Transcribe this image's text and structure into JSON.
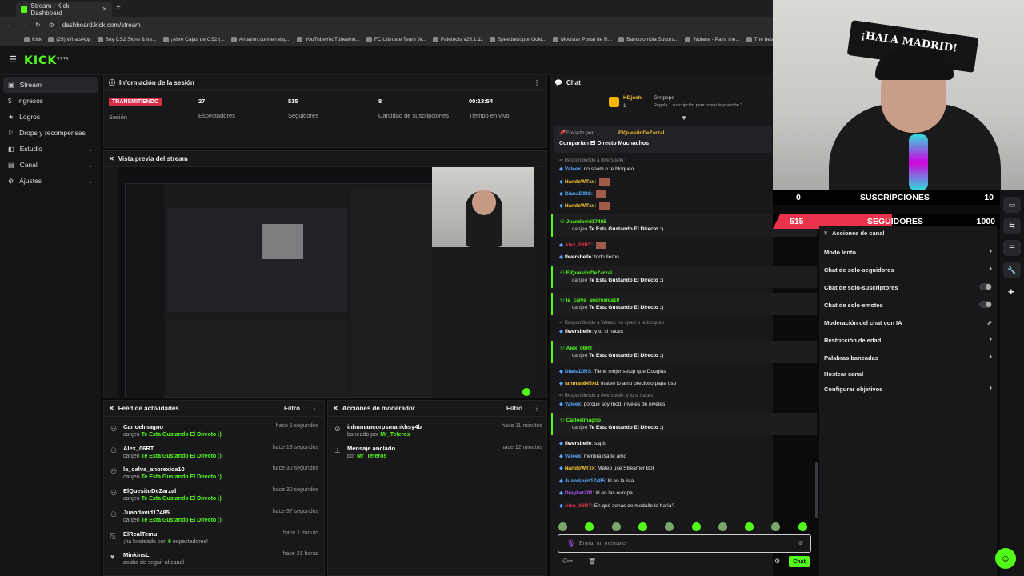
{
  "browser": {
    "tab_title": "Stream - Kick Dashboard",
    "url": "dashboard.kick.com/stream",
    "bookmarks": [
      "Kick",
      "(25) WhatsApp",
      "Buy CS2 Skins & Ite...",
      "¡Abre Cajas de CS2 (...",
      "Amazon.com en esp...",
      "YouTubeYouTubewhtt...",
      "FC Ultimate Team W...",
      "Paletools v25.1.11",
      "Speedtest por Ookl...",
      "Movistar Portal de R...",
      "Bancolombia Sucurs...",
      "Wplace - Paint the...",
      "The best ChatBot an..."
    ]
  },
  "app": {
    "logo": "KICK",
    "logo_tag": "BETA"
  },
  "sidebar": {
    "items": [
      {
        "label": "Stream",
        "icon": "stream-icon",
        "active": true
      },
      {
        "label": "Ingresos",
        "icon": "money-icon"
      },
      {
        "label": "Logros",
        "icon": "trophy-icon"
      },
      {
        "label": "Drops y recompensas",
        "icon": "gift-icon"
      },
      {
        "label": "Estudio",
        "icon": "studio-icon",
        "expandable": true
      },
      {
        "label": "Canal",
        "icon": "channel-icon",
        "expandable": true
      },
      {
        "label": "Ajustes",
        "icon": "gear-icon",
        "expandable": true
      }
    ]
  },
  "session": {
    "title": "Información de la sesión",
    "status": "TRANSMITIENDO",
    "status_label": "Sesión",
    "stats": [
      {
        "value": "27",
        "label": "Espectadores"
      },
      {
        "value": "515",
        "label": "Seguidores"
      },
      {
        "value": "8",
        "label": "Cantidad de suscripciones"
      },
      {
        "value": "00:13:54",
        "label": "Tiempo en vivo"
      }
    ]
  },
  "preview": {
    "title": "Vista previa del stream"
  },
  "feed": {
    "title": "Feed de actividades",
    "filter": "Filtro",
    "rows": [
      {
        "user": "Carloelmagno",
        "pre": "canjeó",
        "highlight": "Te Esta Gustando El Directo :)",
        "time": "hace 5 segundos"
      },
      {
        "user": "Alex_06RT",
        "pre": "canjeó",
        "highlight": "Te Esta Gustando El Directo :)",
        "time": "hace 18 segundos"
      },
      {
        "user": "la_calva_anorexica10",
        "pre": "canjeó",
        "highlight": "Te Esta Gustando El Directo :)",
        "time": "hace 30 segundos"
      },
      {
        "user": "ElQuesitoDeZarzal",
        "pre": "canjeó",
        "highlight": "Te Esta Gustando El Directo :)",
        "time": "hace 30 segundos"
      },
      {
        "user": "Juandavid17485",
        "pre": "canjeó",
        "highlight": "Te Esta Gustando El Directo :)",
        "time": "hace 37 segundos"
      },
      {
        "user": "ElRealTemu",
        "pre": "¡ha hosteado con",
        "highlight": "6",
        "post": "espectadores!",
        "time": "hace 1 minuto"
      },
      {
        "user": "MinkinsL",
        "pre": "acaba de seguir al canal",
        "highlight": "",
        "time": "hace 21 horas"
      }
    ]
  },
  "mod": {
    "title": "Acciones de moderador",
    "filter": "Filtro",
    "rows": [
      {
        "user": "inhumancorpsmankhsy4b",
        "pre": "baneado por",
        "by": "Mr_Teteros",
        "time": "hace 11 minutos"
      },
      {
        "user": "Mensaje anclado",
        "pre": "por",
        "by": "Mr_Teteros",
        "time": "hace 12 minutos"
      }
    ]
  },
  "chat": {
    "title": "Chat",
    "top_gifter": {
      "name": "HDjoshi",
      "count": "1",
      "second": "Grrrpepe",
      "note": "Regala 1 suscripción para tomar la posición 3"
    },
    "pinned": {
      "by_label": "Enviado por",
      "by": "ElQuesitoDeZarzal",
      "text": "Compartan El Directo Muchachos"
    },
    "messages": [
      {
        "reply": "Respondiendo a flwersbelle:",
        "user": "Valeex",
        "color": "#5aa8ff",
        "text": "no spam o te bloqueo"
      },
      {
        "user": "NandoWTxx",
        "color": "#f4c430",
        "text": ""
      },
      {
        "user": "DianaDIRS",
        "color": "#5aa8ff",
        "text": ""
      },
      {
        "user": "NandoWTxx",
        "color": "#f4c430",
        "text": ""
      },
      {
        "user": "Juandavid17485",
        "color": "#53fc18",
        "text": "canjeó",
        "reward": "Te Esta Gustando El Directo :)",
        "hl": true
      },
      {
        "user": "Alex_06RT",
        "color": "#e8334a",
        "text": ""
      },
      {
        "user": "flwersbelle",
        "color": "#ffffff",
        "text": "todo tierno"
      },
      {
        "user": "ElQuesitoDeZarzal",
        "color": "#53fc18",
        "text": "canjeó",
        "reward": "Te Esta Gustando El Directo :)",
        "hl": true
      },
      {
        "user": "la_calva_anorexica10",
        "color": "#53fc18",
        "text": "canjeó",
        "reward": "Te Esta Gustando El Directo :)",
        "hl": true
      },
      {
        "reply": "Respondiendo a Valeex: no spam o te bloqueo",
        "user": "flwersbelle",
        "color": "#ffffff",
        "text": "y tu si haces"
      },
      {
        "user": "Alex_06RT",
        "color": "#53fc18",
        "text": "canjeó",
        "reward": "Te Esta Gustando El Directo :)",
        "hl": true
      },
      {
        "user": "DianaDIRS",
        "color": "#5aa8ff",
        "text": "Tiene mejor setup que Douglas"
      },
      {
        "user": "fanman845xd",
        "color": "#f4c430",
        "text": "mateo lo amo precioso papa oso"
      },
      {
        "reply": "Respondiendo a flwersbelle: y tu si haces",
        "user": "Valeex",
        "color": "#5aa8ff",
        "text": "porque soy mod, niveles de niveles"
      },
      {
        "user": "Carloelmagno",
        "color": "#53fc18",
        "text": "canjeó",
        "reward": "Te Esta Gustando El Directo :)",
        "hl": true
      },
      {
        "user": "flwersbelle",
        "color": "#ffffff",
        "text": "sapis"
      },
      {
        "user": "Valeex",
        "color": "#5aa8ff",
        "text": "mentira lsa te amo"
      },
      {
        "user": "NandoWTxx",
        "color": "#f4c430",
        "text": "Mateo use Streamer Bot"
      },
      {
        "user": "Juandavid17485",
        "color": "#5aa8ff",
        "text": "lrl en la isla"
      },
      {
        "user": "Drayker201",
        "color": "#b05cff",
        "text": "lrl en las europa"
      },
      {
        "user": "Alex_06RT",
        "color": "#e8334a",
        "text": "En qué zonas de medallo lo haría?"
      }
    ],
    "input_placeholder": "Enviar un mensaje",
    "send_label": "Chat"
  },
  "overlay": {
    "subs": {
      "current": "0",
      "label": "SUSCRIPCIONES",
      "goal": "10",
      "progress": 0
    },
    "follows": {
      "current": "515",
      "label": "SEGUIDORES",
      "goal": "1000",
      "progress": 0.515
    },
    "banner_text": "¡HALA MADRID!"
  },
  "channel_actions": {
    "title": "Acciones de canal",
    "items": [
      {
        "label": "Modo lento",
        "kind": "chevron"
      },
      {
        "label": "Chat de solo-seguidores",
        "kind": "chevron"
      },
      {
        "label": "Chat de solo-suscriptores",
        "kind": "toggle"
      },
      {
        "label": "Chat de solo-emotes",
        "kind": "toggle"
      },
      {
        "label": "Moderación del chat con IA",
        "kind": "external"
      },
      {
        "label": "Restricción de edad",
        "kind": "chevron"
      },
      {
        "label": "Palabras baneadas",
        "kind": "chevron"
      },
      {
        "label": "Hostear canal",
        "kind": "none"
      },
      {
        "label": "Configurar objetivos",
        "kind": "chevron"
      }
    ]
  },
  "colors": {
    "accent": "#53fc18",
    "live": "#d92d4a",
    "follow_bar": "#e8334a"
  }
}
